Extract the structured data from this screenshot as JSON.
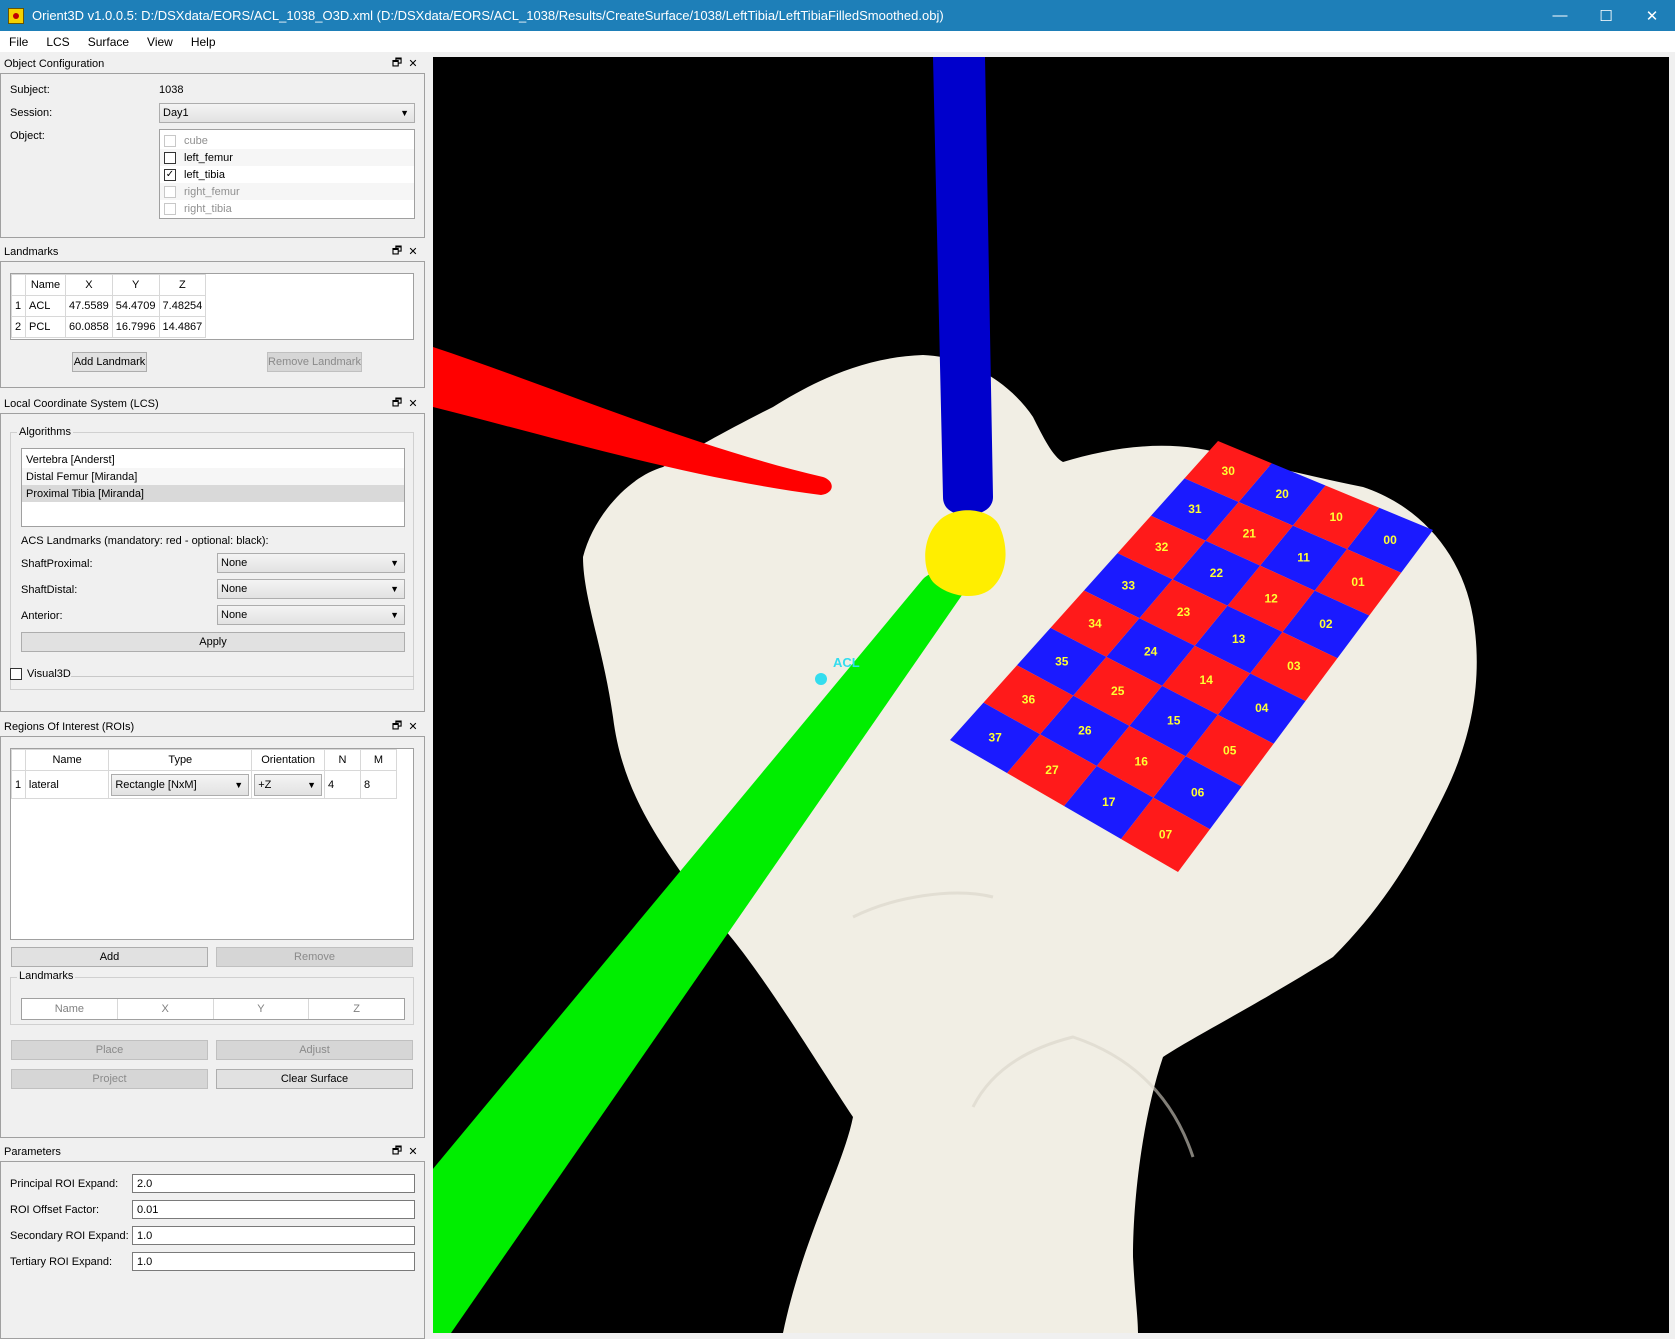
{
  "window": {
    "title": "Orient3D v1.0.0.5: D:/DSXdata/EORS/ACL_1038_O3D.xml (D:/DSXdata/EORS/ACL_1038/Results/CreateSurface/1038/LeftTibia/LeftTibiaFilledSmoothed.obj)",
    "minimize": "—",
    "maximize": "☐",
    "close": "✕"
  },
  "menu": [
    "File",
    "LCS",
    "Surface",
    "View",
    "Help"
  ],
  "object_config": {
    "header": "Object Configuration",
    "subject_label": "Subject:",
    "subject_value": "1038",
    "session_label": "Session:",
    "session_value": "Day1",
    "object_label": "Object:",
    "objects": [
      {
        "name": "cube",
        "checked": false,
        "enabled": false
      },
      {
        "name": "left_femur",
        "checked": false,
        "enabled": true
      },
      {
        "name": "left_tibia",
        "checked": true,
        "enabled": true
      },
      {
        "name": "right_femur",
        "checked": false,
        "enabled": false
      },
      {
        "name": "right_tibia",
        "checked": false,
        "enabled": false
      }
    ]
  },
  "landmarks": {
    "header": "Landmarks",
    "columns": [
      "Name",
      "X",
      "Y",
      "Z"
    ],
    "rows": [
      {
        "index": "1",
        "name": "ACL",
        "x": "47.5589",
        "y": "54.4709",
        "z": "7.48254"
      },
      {
        "index": "2",
        "name": "PCL",
        "x": "60.0858",
        "y": "16.7996",
        "z": "14.4867"
      }
    ],
    "add_button": "Add Landmark",
    "remove_button": "Remove Landmark"
  },
  "lcs": {
    "header": "Local Coordinate System (LCS)",
    "algorithms_title": "Algorithms",
    "algorithms": [
      "Vertebra [Anderst]",
      "Distal Femur [Miranda]",
      "Proximal Tibia [Miranda]"
    ],
    "acs_label": "ACS Landmarks (mandatory: red - optional: black):",
    "shaft_proximal_label": "ShaftProximal:",
    "shaft_proximal_value": "None",
    "shaft_distal_label": "ShaftDistal:",
    "shaft_distal_value": "None",
    "anterior_label": "Anterior:",
    "anterior_value": "None",
    "apply_button": "Apply",
    "visual3d_label": "Visual3D"
  },
  "rois": {
    "header": "Regions Of Interest (ROIs)",
    "columns": [
      "Name",
      "Type",
      "Orientation",
      "N",
      "M"
    ],
    "rows": [
      {
        "index": "1",
        "name": "lateral",
        "type": "Rectangle [NxM]",
        "orientation": "+Z",
        "n": "4",
        "m": "8"
      }
    ],
    "add_button": "Add",
    "remove_button": "Remove",
    "landmarks_title": "Landmarks",
    "landmark_columns": [
      "Name",
      "X",
      "Y",
      "Z"
    ],
    "place_button": "Place",
    "adjust_button": "Adjust",
    "project_button": "Project",
    "clear_surface_button": "Clear Surface"
  },
  "parameters": {
    "header": "Parameters",
    "fields": [
      {
        "label": "Principal ROI Expand:",
        "value": "2.0"
      },
      {
        "label": "ROI Offset Factor:",
        "value": "0.01"
      },
      {
        "label": "Secondary ROI Expand:",
        "value": "1.0"
      },
      {
        "label": "Tertiary ROI Expand:",
        "value": "1.0"
      }
    ]
  },
  "viewport": {
    "landmark_label": "ACL",
    "grid_labels": [
      "00",
      "01",
      "02",
      "03",
      "04",
      "05",
      "06",
      "07",
      "10",
      "11",
      "12",
      "13",
      "14",
      "15",
      "16",
      "17",
      "20",
      "21",
      "22",
      "23",
      "24",
      "25",
      "26",
      "27",
      "30",
      "31",
      "32",
      "33",
      "34",
      "35",
      "36",
      "37"
    ],
    "colors": {
      "background": "#000000",
      "bone": "#f1eee4",
      "x_axis": "#ff0000",
      "y_axis": "#00ee00",
      "z_axis": "#0000cc",
      "origin": "#ffee00",
      "grid_a": "#ff1a1a",
      "grid_b": "#1a1aff",
      "label": "#ffff33",
      "landmark": "#33ddee"
    }
  }
}
